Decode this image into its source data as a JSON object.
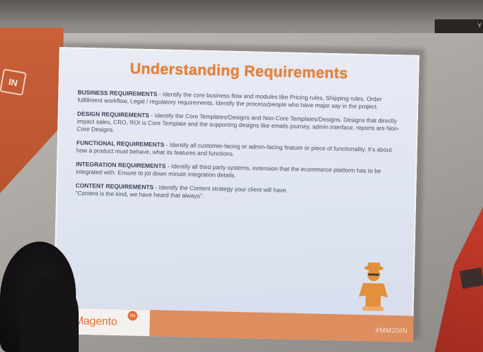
{
  "slide": {
    "title": "Understanding Requirements",
    "sections": [
      {
        "heading": "BUSINESS REQUIREMENTS",
        "text": " - Identify the core business flow and modules like Pricing rules, Shipping rules, Order fulfillment workflow, Legal / regulatory requirements. Identify the process/people who have major say in the project."
      },
      {
        "heading": "DESIGN REQUIREMENTS",
        "text": " - Identify the Core Templates/Designs and Non-Core Templates/Designs. Designs that directly impact sales, CRO, ROI is Core Template and the supporting designs like emails journey, admin interface, reports are Non-Core Designs."
      },
      {
        "heading": "FUNCTIONAL REQUIREMENTS",
        "text": " - Identify all customer-facing or admin-facing feature or piece of functionality. It's about how a product must behave, what its features and functions."
      },
      {
        "heading": "INTEGRATION REQUIREMENTS",
        "text": " - Identify all third party systems, extension that the ecommerce platform has to be integrated with. Ensure to jot down minute integration details."
      },
      {
        "heading": "CONTENT REQUIREMENTS",
        "text": " - Identify the Content strategy your client will have.",
        "quote": "\"Content is the kind, we have heard that always\"."
      }
    ],
    "footer": {
      "brand": "eet Magento",
      "badge": "IN",
      "hashtag": "#MM20IN"
    }
  },
  "room": {
    "banner_logo": "IN",
    "corner_text": "Y"
  },
  "colors": {
    "title": "#e5833a",
    "footer": "#dd8d5e",
    "banner": "#c9603a"
  }
}
